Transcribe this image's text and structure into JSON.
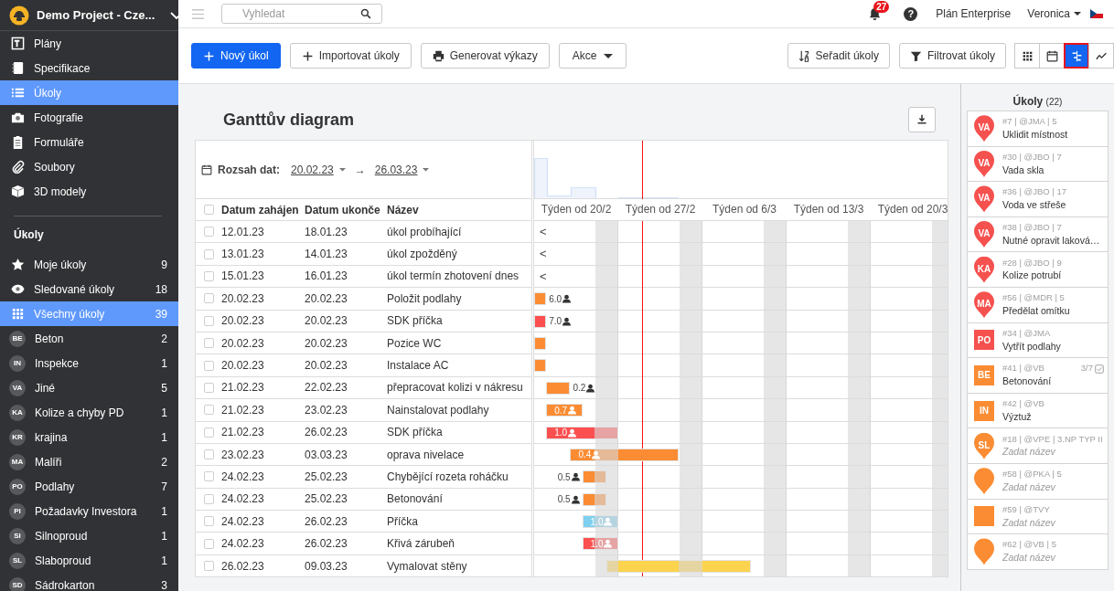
{
  "sidebar": {
    "project": "Demo Project - Cze...",
    "nav": [
      {
        "label": "Plány",
        "selected": false
      },
      {
        "label": "Specifikace",
        "selected": false
      },
      {
        "label": "Úkoly",
        "selected": true
      },
      {
        "label": "Fotografie",
        "selected": false
      },
      {
        "label": "Formuláře",
        "selected": false
      },
      {
        "label": "Soubory",
        "selected": false
      },
      {
        "label": "3D modely",
        "selected": false
      }
    ],
    "section_title": "Úkoly",
    "filters": [
      {
        "label": "Moje úkoly",
        "count": "9",
        "selected": false
      },
      {
        "label": "Sledované úkoly",
        "count": "18",
        "selected": false
      },
      {
        "label": "Všechny úkoly",
        "count": "39",
        "selected": true
      }
    ],
    "categories": [
      {
        "initials": "BE",
        "label": "Beton",
        "count": "2",
        "selected": false
      },
      {
        "initials": "IN",
        "label": "Inspekce",
        "count": "1",
        "selected": false
      },
      {
        "initials": "VA",
        "label": "Jiné",
        "count": "5",
        "selected": false
      },
      {
        "initials": "KA",
        "label": "Kolize a chyby PD",
        "count": "1",
        "selected": false
      },
      {
        "initials": "KR",
        "label": "krajina",
        "count": "1",
        "selected": false
      },
      {
        "initials": "MA",
        "label": "Malíři",
        "count": "2",
        "selected": false
      },
      {
        "initials": "PO",
        "label": "Podlahy",
        "count": "7",
        "selected": false
      },
      {
        "initials": "PI",
        "label": "Požadavky Investora",
        "count": "1",
        "selected": false
      },
      {
        "initials": "SI",
        "label": "Silnoproud",
        "count": "1",
        "selected": false
      },
      {
        "initials": "SL",
        "label": "Slaboproud",
        "count": "1",
        "selected": false
      },
      {
        "initials": "SD",
        "label": "Sádrokarton",
        "count": "3",
        "selected": false
      }
    ]
  },
  "topbar": {
    "search": {
      "placeholder": "Vyhledat"
    },
    "notifications": "27",
    "help": "?",
    "plan": "Plán Enterprise",
    "user": "Veronica"
  },
  "toolbar": {
    "left": [
      {
        "label": "Nový úkol",
        "kind": "primary"
      },
      {
        "label": "Importovat úkoly",
        "kind": "plain"
      },
      {
        "label": "Generovat výkazy",
        "kind": "plain"
      },
      {
        "label": "Akce",
        "kind": "dropdown"
      }
    ],
    "right": [
      {
        "label": "Seřadit úkoly"
      },
      {
        "label": "Filtrovat úkoly"
      }
    ],
    "views": [
      {
        "selected": false
      },
      {
        "selected": false
      },
      {
        "selected": true
      },
      {
        "selected": false
      }
    ]
  },
  "gantt": {
    "title": "Ganttův diagram",
    "range": {
      "label": "Rozsah dat:",
      "from": "20.02.23",
      "arrow": "→",
      "to": "26.03.23"
    },
    "select_all": {
      "checked": false
    },
    "columns": [
      {
        "label": "Datum zahájen"
      },
      {
        "label": "Datum ukonče"
      },
      {
        "label": "Název"
      }
    ],
    "weeks": [
      {
        "label": "Týden od 20/2"
      },
      {
        "label": "Týden od 27/2"
      },
      {
        "label": "Týden od 6/3"
      },
      {
        "label": "Týden od 13/3"
      },
      {
        "label": "Týden od 20/3"
      }
    ],
    "today": {
      "level": 0.2571
    },
    "rows": [
      {
        "start": "12.01.23",
        "end": "18.01.23",
        "name": "úkol probíhající",
        "checked": false,
        "marker": "<"
      },
      {
        "start": "13.01.23",
        "end": "14.01.23",
        "name": "úkol zpožděný",
        "checked": false,
        "marker": "<"
      },
      {
        "start": "15.01.23",
        "end": "16.01.23",
        "name": "úkol termín zhotovení dnes",
        "checked": false,
        "marker": "<"
      },
      {
        "start": "20.02.23",
        "end": "20.02.23",
        "name": "Položit podlahy",
        "checked": false,
        "bar": {
          "color": "#fb8c33",
          "label": "6.0",
          "kind": "outside"
        }
      },
      {
        "start": "20.02.23",
        "end": "20.02.23",
        "name": "SDK příčka",
        "checked": false,
        "bar": {
          "color": "#fc4f4f",
          "label": "7.0",
          "kind": "outside"
        }
      },
      {
        "start": "20.02.23",
        "end": "20.02.23",
        "name": "Pozice WC",
        "checked": false,
        "bar": {
          "color": "#fb8c33"
        }
      },
      {
        "start": "20.02.23",
        "end": "20.02.23",
        "name": "Instalace AC",
        "checked": false,
        "bar": {
          "color": "#fb8c33"
        }
      },
      {
        "start": "21.02.23",
        "end": "22.02.23",
        "name": "přepracovat kolizi v nákresu",
        "checked": false,
        "bar": {
          "color": "#fb8c33",
          "label": "0.2",
          "kind": "outside"
        }
      },
      {
        "start": "21.02.23",
        "end": "23.02.23",
        "name": "Nainstalovat podlahy",
        "checked": false,
        "bar": {
          "color": "#fb8c33",
          "label": "0.7",
          "kind": "inside"
        }
      },
      {
        "start": "21.02.23",
        "end": "26.02.23",
        "name": "SDK příčka",
        "checked": false,
        "bar": {
          "color": "#fc4f4f",
          "label": "1.0",
          "kind": "inside"
        }
      },
      {
        "start": "23.02.23",
        "end": "03.03.23",
        "name": "oprava nivelace",
        "checked": false,
        "bar": {
          "color": "#fb8c33",
          "label": "0.4",
          "kind": "inside"
        }
      },
      {
        "start": "24.02.23",
        "end": "25.02.23",
        "name": "Chybějící rozeta roháčku",
        "checked": false,
        "bar": {
          "color": "#fb8c33",
          "label": "0.5",
          "kind": "before"
        }
      },
      {
        "start": "24.02.23",
        "end": "25.02.23",
        "name": "Betonování",
        "checked": false,
        "bar": {
          "color": "#fb8c33",
          "label": "0.5",
          "kind": "before"
        }
      },
      {
        "start": "24.02.23",
        "end": "26.02.23",
        "name": "Příčka",
        "checked": false,
        "bar": {
          "color": "#7fcff0",
          "label": "1.0",
          "kind": "inside"
        }
      },
      {
        "start": "24.02.23",
        "end": "26.02.23",
        "name": "Křivá zárubeň",
        "checked": false,
        "bar": {
          "color": "#fc4f4f",
          "label": "1.0",
          "kind": "inside"
        }
      },
      {
        "start": "26.02.23",
        "end": "09.03.23",
        "name": "Vymalovat stěny",
        "checked": false,
        "bar": {
          "color": "#fcd34d"
        }
      }
    ]
  },
  "tasks_panel": {
    "title": "Úkoly",
    "count": "(22)",
    "items": [
      {
        "kind": "pin",
        "color": "#f5514f",
        "initials": "VA",
        "meta": "#7 | @JMA | 5",
        "title": "Uklidit místnost",
        "untitled": false
      },
      {
        "kind": "pin",
        "color": "#f5514f",
        "initials": "VA",
        "meta": "#30 | @JBO | 7",
        "title": "Vada skla",
        "untitled": false
      },
      {
        "kind": "pin",
        "color": "#f5514f",
        "initials": "VA",
        "meta": "#36 | @JBO | 17",
        "title": "Voda ve střeše",
        "untitled": false
      },
      {
        "kind": "pin",
        "color": "#f5514f",
        "initials": "VA",
        "meta": "#38 | @JBO | 7",
        "title": "Nutné opravit laková…",
        "untitled": false
      },
      {
        "kind": "pin",
        "color": "#f5514f",
        "initials": "KA",
        "meta": "#28 | @JBO | 9",
        "title": "Kolize potrubí",
        "untitled": false
      },
      {
        "kind": "pin",
        "color": "#f5514f",
        "initials": "MA",
        "meta": "#56 | @MDR | 5",
        "title": "Předělat omítku",
        "untitled": false
      },
      {
        "kind": "square",
        "color": "#f5514f",
        "initials": "PO",
        "meta": "#34 | @JMA",
        "title": "Vytřít podlahy",
        "untitled": false
      },
      {
        "kind": "square",
        "color": "#fb8c33",
        "initials": "BE",
        "meta": "#41 | @VB",
        "progress": "3/7",
        "title": "Betonování",
        "untitled": false
      },
      {
        "kind": "square",
        "color": "#fb8c33",
        "initials": "IN",
        "meta": "#42 | @VB",
        "title": "Výztuž",
        "untitled": false
      },
      {
        "kind": "pin",
        "color": "#fb8c33",
        "initials": "SL",
        "meta": "#18 | @VPE | 3.NP TYP II",
        "title": "Zadat název",
        "untitled": true
      },
      {
        "kind": "pin",
        "color": "#fb8c33",
        "meta": "#58 | @PKA | 5",
        "title": "Zadat název",
        "untitled": true
      },
      {
        "kind": "square",
        "color": "#fb8c33",
        "meta": "#59 | @TVY",
        "title": "Zadat název",
        "untitled": true
      },
      {
        "kind": "pin",
        "color": "#fb8c33",
        "meta": "#62 | @VB | 5",
        "title": "Zadat název",
        "untitled": true
      }
    ]
  }
}
